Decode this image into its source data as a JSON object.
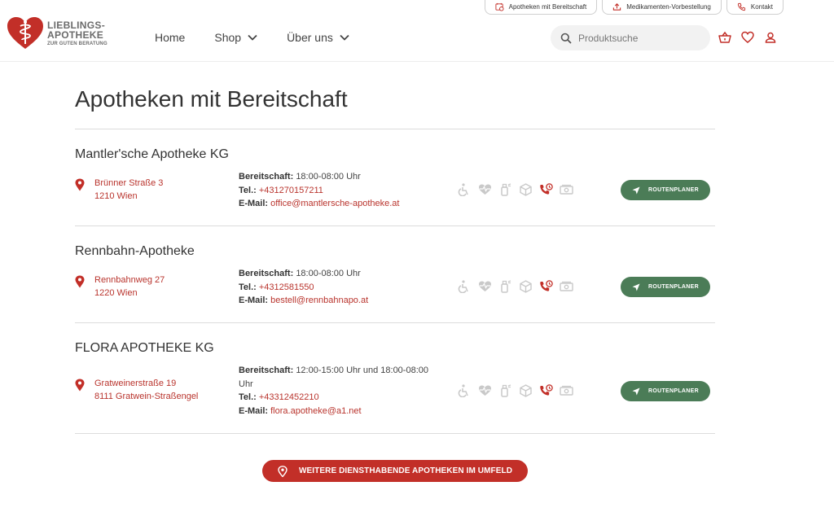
{
  "utility_bar": {
    "items": [
      {
        "label": "Apotheken mit Bereitschaft",
        "icon": "calendar-clock-icon"
      },
      {
        "label": "Medikamenten-Vorbestellung",
        "icon": "upload-icon"
      },
      {
        "label": "Kontakt",
        "icon": "phone-icon"
      }
    ]
  },
  "logo": {
    "line1": "LIEBLINGS-",
    "line2": "APOTHEKE",
    "line3": "ZUR GUTEN BERATUNG"
  },
  "nav": {
    "home": "Home",
    "shop": "Shop",
    "about": "Über uns"
  },
  "search": {
    "placeholder": "Produktsuche"
  },
  "page": {
    "title": "Apotheken mit Bereitschaft"
  },
  "labels": {
    "bereitschaft": "Bereitschaft:",
    "tel": "Tel.:",
    "email": "E-Mail:",
    "route": "ROUTENPLANER"
  },
  "pharmacies": [
    {
      "name": "Mantler'sche Apotheke KG",
      "street": "Brünner Straße 3",
      "city": "1210 Wien",
      "hours": "18:00-08:00 Uhr",
      "tel": "+431270157211",
      "email": "office@mantlersche-apotheke.at"
    },
    {
      "name": "Rennbahn-Apotheke",
      "street": "Rennbahnweg 27",
      "city": "1220 Wien",
      "hours": "18:00-08:00 Uhr",
      "tel": "+4312581550",
      "email": "bestell@rennbahnapo.at"
    },
    {
      "name": "FLORA APOTHEKE KG",
      "street": "Gratweinerstraße 19",
      "city": "8111 Gratwein-Straßengel",
      "hours": "12:00-15:00 Uhr und 18:00-08:00 Uhr",
      "tel": "+43312452210",
      "email": "flora.apotheke@a1.net"
    }
  ],
  "more_button": {
    "label": "WEITERE DIENSTHABENDE APOTHEKEN IM UMFELD"
  },
  "colors": {
    "brand_red": "#c22f28",
    "link_red": "#b9342d",
    "route_green": "#4b7c57",
    "icon_grey": "#c9c9c9"
  }
}
